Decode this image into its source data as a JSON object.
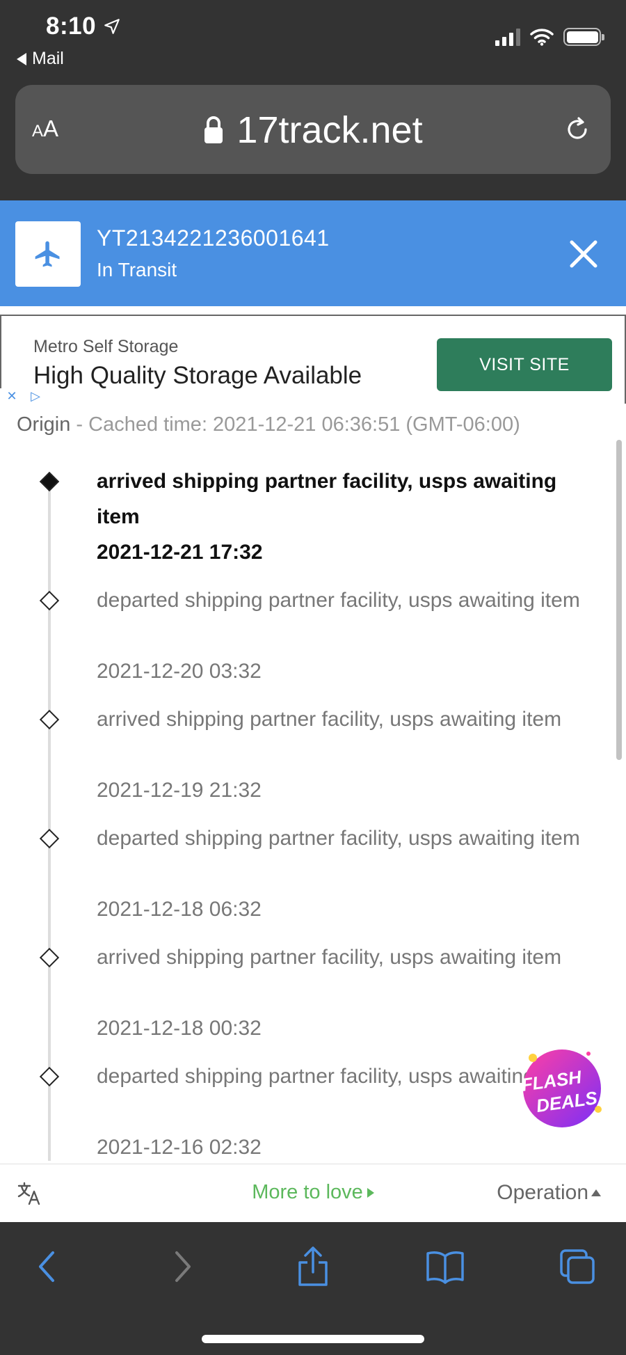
{
  "status_bar": {
    "time": "8:10",
    "back_label": "Mail"
  },
  "browser": {
    "text_size_label": "AA",
    "url": "17track.net"
  },
  "tracking": {
    "number": "YT2134221236001641",
    "status": "In Transit"
  },
  "ad": {
    "advertiser": "Metro Self Storage",
    "headline": "High Quality Storage Available",
    "button": "VISIT SITE"
  },
  "origin": {
    "label": "Origin",
    "separator": " - ",
    "cached": "Cached time: 2021-12-21 06:36:51 (GMT-06:00)"
  },
  "events": [
    {
      "description": "arrived shipping partner facility, usps awaiting item",
      "time": "2021-12-21 17:32"
    },
    {
      "description": "departed shipping partner facility, usps awaiting item",
      "time": "2021-12-20 03:32"
    },
    {
      "description": "arrived shipping partner facility, usps awaiting item",
      "time": "2021-12-19 21:32"
    },
    {
      "description": "departed shipping partner facility, usps awaiting item",
      "time": "2021-12-18 06:32"
    },
    {
      "description": "arrived shipping partner facility, usps awaiting item",
      "time": "2021-12-18 00:32"
    },
    {
      "description": "departed shipping partner facility, usps awaiting item",
      "time": "2021-12-16 02:32"
    }
  ],
  "flash_deals": {
    "line1": "FLASH",
    "line2": "DEALS"
  },
  "page_footer": {
    "more_to_love": "More to love",
    "operation": "Operation"
  },
  "colors": {
    "header_blue": "#4a90e2",
    "ad_button_green": "#2e7d5b",
    "more_to_love_green": "#5cb85c",
    "ios_chrome": "#333333",
    "toolbar_blue": "#4a90e2"
  },
  "icons": {
    "location_arrow": "location-arrow-icon",
    "lock": "lock-icon",
    "reload": "reload-icon",
    "plane": "airplane-icon",
    "close": "close-icon",
    "translate": "translate-icon",
    "back": "chevron-left-icon",
    "forward": "chevron-right-icon",
    "share": "share-icon",
    "bookmarks": "book-icon",
    "tabs": "tabs-icon"
  }
}
